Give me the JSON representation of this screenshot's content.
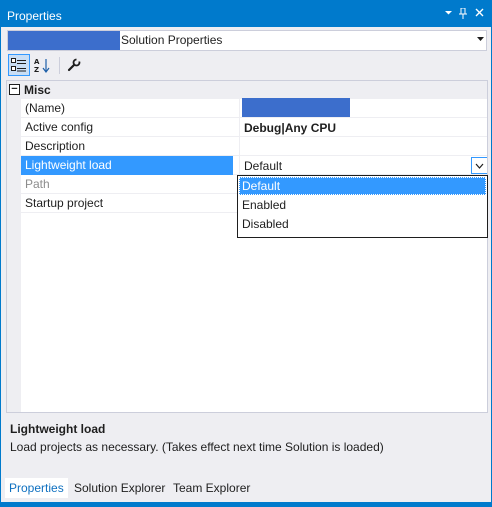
{
  "window": {
    "title": "Properties",
    "title_icons": [
      "chevron-down-icon",
      "pin-icon",
      "close-icon"
    ]
  },
  "object_selector": {
    "selected_text": "Solution Properties"
  },
  "toolbar": {
    "buttons": [
      "categorized-icon",
      "alphabetical-icon",
      "property-pages-icon"
    ],
    "categorized_label": "A",
    "alpha_top": "A",
    "alpha_bottom": "Z"
  },
  "grid": {
    "category": {
      "label": "Misc",
      "toggle": "−"
    },
    "rows": [
      {
        "name": "(Name)",
        "value": ""
      },
      {
        "name": "Active config",
        "value": "Debug|Any CPU"
      },
      {
        "name": "Description",
        "value": ""
      },
      {
        "name": "Lightweight load",
        "value": "Default"
      },
      {
        "name": "Path",
        "value": ""
      },
      {
        "name": "Startup project",
        "value": ""
      }
    ]
  },
  "dropdown": {
    "options": [
      "Default",
      "Enabled",
      "Disabled"
    ],
    "selected": "Default"
  },
  "description": {
    "title": "Lightweight load",
    "text": "Load projects as necessary. (Takes effect next time Solution is loaded)"
  },
  "tabs": [
    {
      "label": "Properties",
      "active": true
    },
    {
      "label": "Solution Explorer",
      "active": false
    },
    {
      "label": "Team Explorer",
      "active": false
    }
  ],
  "colors": {
    "accent": "#007acc",
    "selection": "#3399ff",
    "redaction": "#3c6ecc"
  }
}
